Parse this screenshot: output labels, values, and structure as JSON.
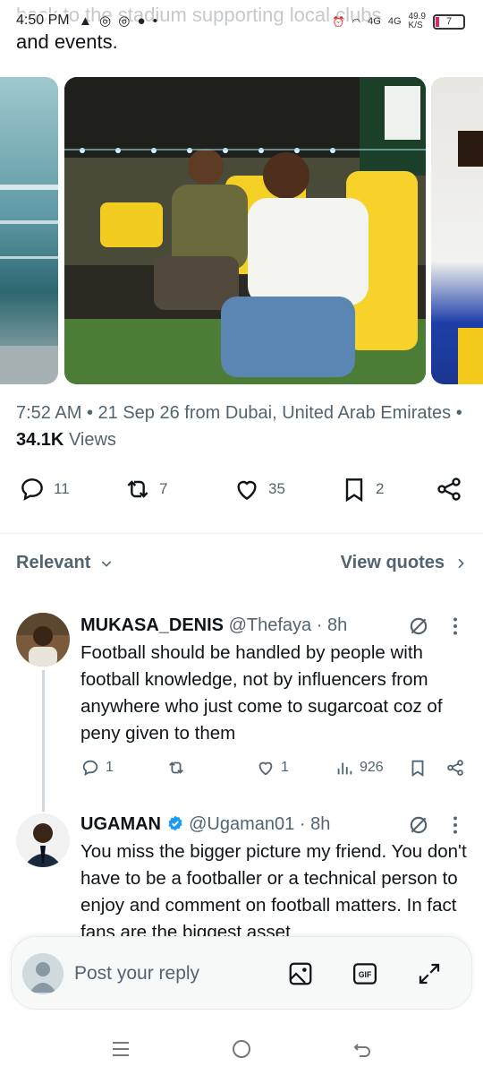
{
  "tweet": {
    "text_tail_1": "back to the stadium supporting local clubs",
    "text_tail_2": "and events.",
    "time": "7:52 AM",
    "date": "21 Sep 26",
    "location": "from Dubai, United Arab Emirates",
    "views_count": "34.1K",
    "views_label": "Views",
    "replies": "11",
    "reposts": "7",
    "likes": "35",
    "bookmarks": "2"
  },
  "status_bar": {
    "time": "4:50 PM",
    "network_1": "4G",
    "network_2": "4G",
    "speed": "49.9",
    "speed_unit": "K/S",
    "battery": "7"
  },
  "sort": {
    "label": "Relevant",
    "quotes": "View quotes"
  },
  "replies": [
    {
      "name": "MUKASA_DENIS",
      "handle": "@Thefaya",
      "time": "8h",
      "verified": false,
      "text": "Football should be handled by people with football knowledge, not by influencers from anywhere who just come to sugarcoat coz of peny given to them",
      "reply_count": "1",
      "repost_count": "",
      "like_count": "1",
      "view_count": "926"
    },
    {
      "name": "UGAMAN",
      "handle": "@Ugaman01",
      "time": "8h",
      "verified": true,
      "text": "You miss the bigger picture my friend. You don't have to be a footballer or a technical person to enjoy and comment on football matters. In fact fans are the biggest asset"
    }
  ],
  "compose": {
    "placeholder": "Post your reply"
  },
  "colors": {
    "accent": "#1d9bf0",
    "secondary_text": "#536471",
    "primary_text": "#0f1419"
  }
}
